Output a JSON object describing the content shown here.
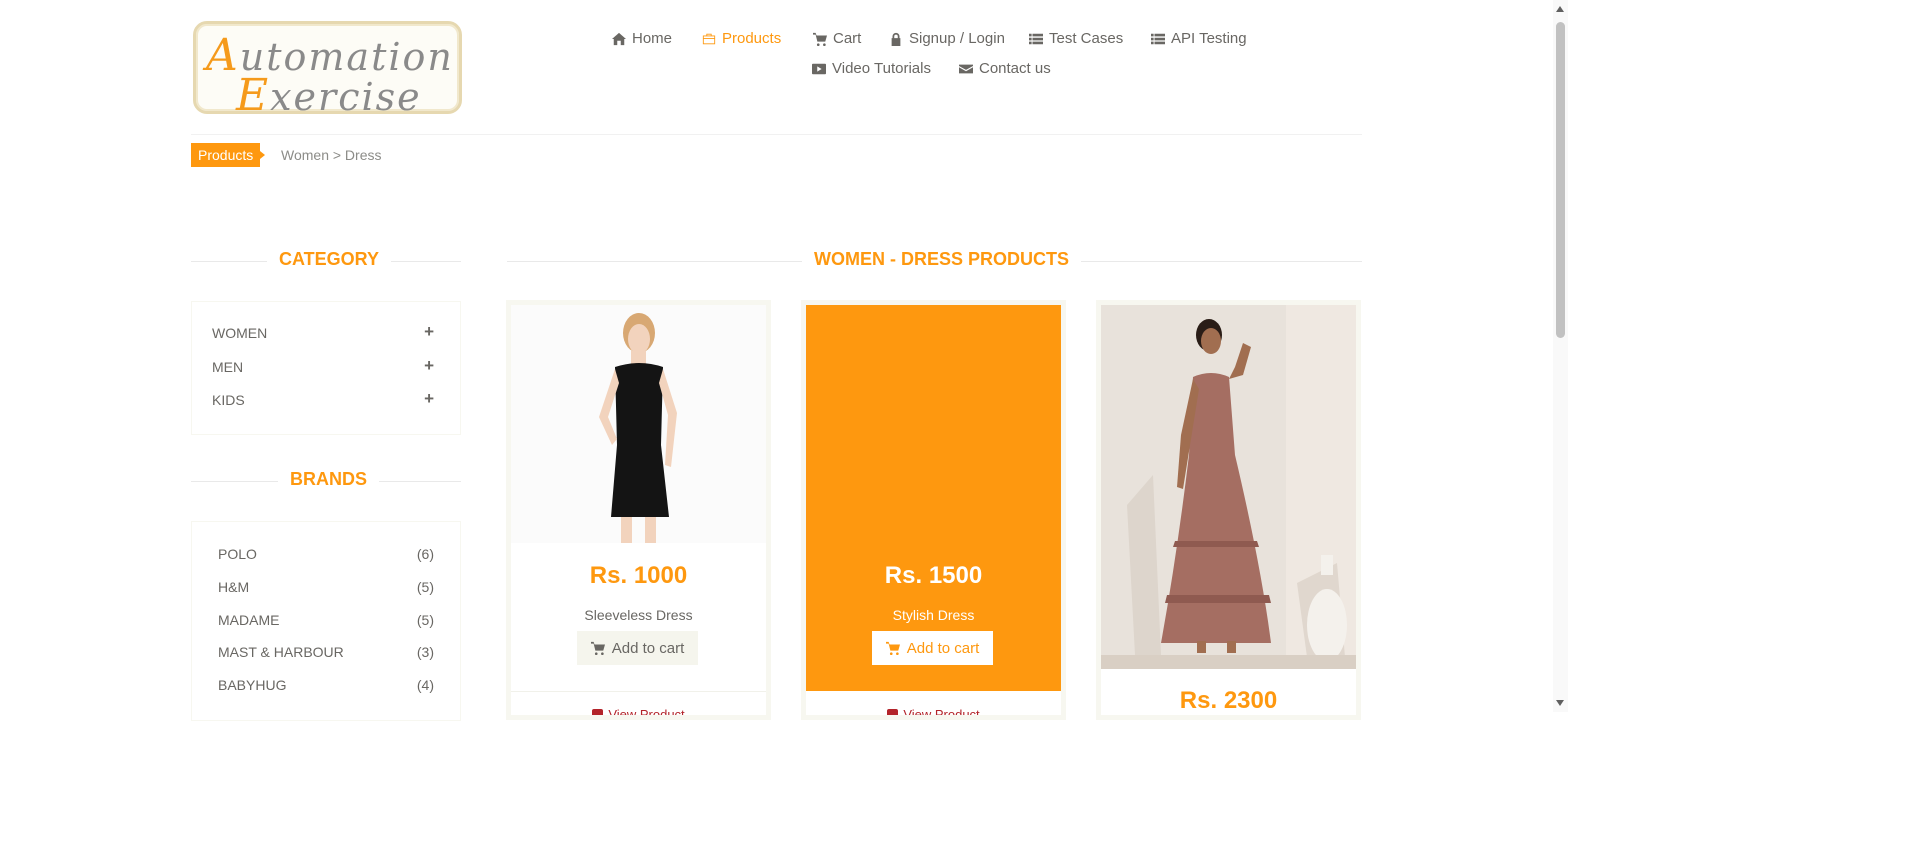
{
  "logo": {
    "line1_cap": "A",
    "line1_rest": "utomation",
    "line2_cap": "E",
    "line2_rest": "xercise"
  },
  "nav": [
    {
      "label": "Home",
      "icon": "home-icon"
    },
    {
      "label": "Products",
      "icon": "products-icon",
      "active": true
    },
    {
      "label": "Cart",
      "icon": "cart-icon"
    },
    {
      "label": "Signup / Login",
      "icon": "lock-icon"
    },
    {
      "label": "Test Cases",
      "icon": "list-icon"
    },
    {
      "label": "API Testing",
      "icon": "list-icon"
    },
    {
      "label": "Video Tutorials",
      "icon": "youtube-icon"
    },
    {
      "label": "Contact us",
      "icon": "envelope-icon"
    }
  ],
  "breadcrumb": {
    "tag": "Products",
    "path": "Women > Dress"
  },
  "sidebar": {
    "category_title": "CATEGORY",
    "categories": [
      {
        "label": "WOMEN",
        "toggle": "+"
      },
      {
        "label": "MEN",
        "toggle": "+"
      },
      {
        "label": "KIDS",
        "toggle": "+"
      }
    ],
    "brands_title": "BRANDS",
    "brands": [
      {
        "name": "POLO",
        "count": "(6)"
      },
      {
        "name": "H&M",
        "count": "(5)"
      },
      {
        "name": "MADAME",
        "count": "(5)"
      },
      {
        "name": "MAST & HARBOUR",
        "count": "(3)"
      },
      {
        "name": "BABYHUG",
        "count": "(4)"
      }
    ]
  },
  "main": {
    "title": "WOMEN - DRESS PRODUCTS",
    "products": [
      {
        "price": "Rs. 1000",
        "name": "Sleeveless Dress",
        "add_label": "Add to cart",
        "view_label": "View Product"
      },
      {
        "price": "Rs. 1500",
        "name": "Stylish Dress",
        "add_label": "Add to cart",
        "view_label": "View Product",
        "hovered": true
      },
      {
        "price": "Rs. 2300"
      }
    ]
  },
  "colors": {
    "accent": "#fe980f",
    "text": "#696763",
    "view_link": "#b3232a"
  }
}
